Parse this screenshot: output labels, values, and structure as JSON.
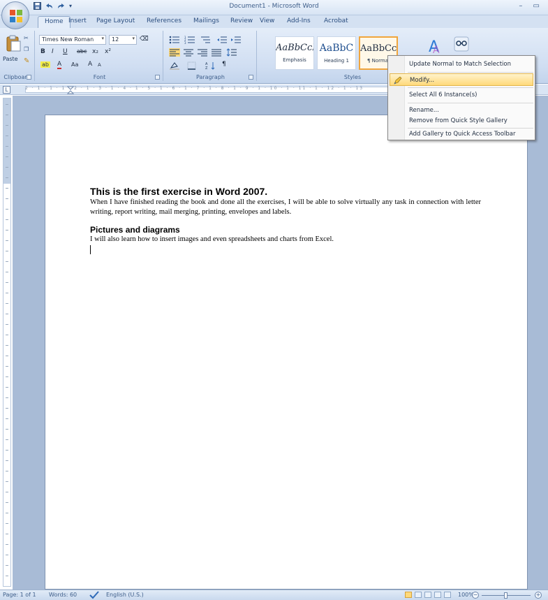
{
  "window": {
    "title": "Document1 - Microsoft Word",
    "controls": "– ▭"
  },
  "tabs": [
    "Home",
    "Insert",
    "Page Layout",
    "References",
    "Mailings",
    "Review",
    "View",
    "Add-Ins",
    "Acrobat"
  ],
  "ribbon": {
    "clipboard": {
      "paste_label": "Paste",
      "group_label": "Clipboard"
    },
    "font": {
      "font_name": "Times New Roman",
      "font_size": "12",
      "bold": "B",
      "italic": "I",
      "underline": "U",
      "strikethrough": "abc",
      "subscript": "x₂",
      "superscript": "x²",
      "change_case": "Aa",
      "grow_font": "A",
      "shrink_font": "A",
      "group_label": "Font"
    },
    "paragraph": {
      "group_label": "Paragraph",
      "show_marks": "¶"
    },
    "styles": {
      "group_label": "Styles",
      "items": [
        {
          "sample": "AaBbCcL",
          "name": "Emphasis"
        },
        {
          "sample": "AaBbC",
          "name": "Heading 1"
        },
        {
          "sample": "AaBbCcI",
          "name": "¶ Normal"
        }
      ]
    }
  },
  "ruler_numbers": "2 · 1 · 1 · 1 · 2 · 1 · 3 · 1 · 4 · 1 · 5 · 1 · 6 · 1 · 7 · 1 · 8 · 1 · 9 · 1 · 10 · 1 · 11 · 1 · 12 · 1 · 13",
  "document": {
    "heading1": "This is the first exercise in Word 2007.",
    "para1": "When I have finished reading the book and done all the exercises, I will be able to solve virtually any task in connection with letter writing, report writing, mail merging, printing, envelopes and labels.",
    "heading2": "Pictures and diagrams",
    "para2": "I will also learn how to insert images and even spreadsheets and charts from Excel."
  },
  "context_menu": {
    "items": [
      {
        "label": "Update Normal to Match Selection",
        "highlighted": false
      },
      {
        "label": "Modify...",
        "highlighted": true
      },
      {
        "label": "Select All 6 Instance(s)",
        "highlighted": false
      },
      {
        "label": "Rename...",
        "highlighted": false
      },
      {
        "label": "Remove from Quick Style Gallery",
        "highlighted": false
      },
      {
        "label": "Add Gallery to Quick Access Toolbar",
        "highlighted": false
      }
    ]
  },
  "statusbar": {
    "page": "Page: 1 of 1",
    "words": "Words: 60",
    "language": "English (U.S.)",
    "zoom": "100%",
    "zoom_out": "−",
    "zoom_in": "+"
  },
  "colors": {
    "accent": "#f0a53c",
    "ribbon": "#d0def2",
    "workspace": "#a8bbd6"
  },
  "icons": [
    "office-logo-icon",
    "save-icon",
    "undo-icon",
    "redo-icon",
    "paste-icon",
    "cut-icon",
    "copy-icon",
    "format-painter-icon",
    "bullets-icon",
    "numbering-icon",
    "multilevel-icon",
    "decrease-indent-icon",
    "increase-indent-icon",
    "align-left-icon",
    "center-icon",
    "align-right-icon",
    "justify-icon",
    "line-spacing-icon",
    "shading-icon",
    "borders-icon",
    "sort-icon",
    "change-styles-icon",
    "find-icon",
    "proofing-icon"
  ]
}
